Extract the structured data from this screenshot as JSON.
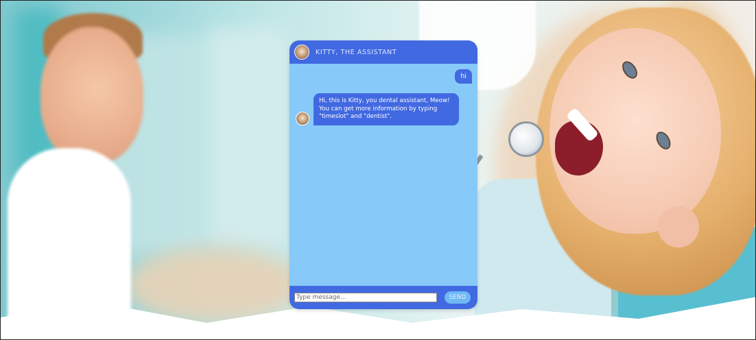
{
  "chat": {
    "title": "KITTY, THE ASSISTANT",
    "messages": [
      {
        "from": "user",
        "text": "hi"
      },
      {
        "from": "bot",
        "lines": [
          "Hi, this is Kitty, you dental assistant, Meow!",
          "You can get more information by typing",
          "\"timeslot\" and \"dentist\"."
        ]
      }
    ],
    "input": {
      "placeholder": "Type message...",
      "value": ""
    },
    "send_label": "SEND"
  },
  "colors": {
    "header": "#4169e1",
    "body": "#87c9f9",
    "bubble": "#4169e1",
    "send_button": "#6fb8f4"
  },
  "icons": {
    "avatar": "kitty-avatar-icon"
  }
}
